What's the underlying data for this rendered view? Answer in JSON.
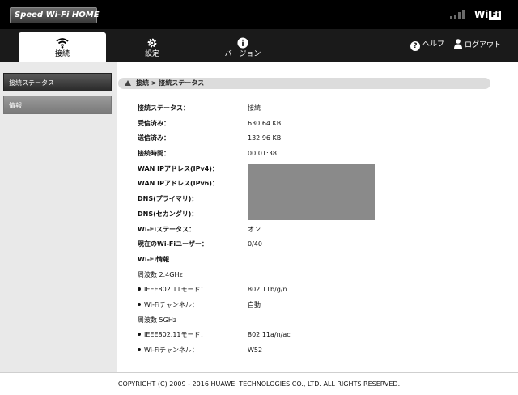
{
  "header": {
    "logo_text": "Speed Wi-Fi HOME",
    "wifi_logo": "WiFi"
  },
  "nav": {
    "tabs": [
      {
        "label": "接続",
        "icon": "wifi-connection-icon"
      },
      {
        "label": "設定",
        "icon": "gear-icon"
      },
      {
        "label": "バージョン",
        "icon": "info-icon"
      }
    ],
    "help_label": "ヘルプ",
    "logout_label": "ログアウト"
  },
  "sidebar": {
    "items": [
      {
        "label": "接続ステータス"
      },
      {
        "label": "情報"
      }
    ]
  },
  "breadcrumb": "接続 > 接続ステータス",
  "status": {
    "connection_status": {
      "label": "接続ステータス：",
      "value": "接続"
    },
    "received": {
      "label": "受信済み：",
      "value": "630.64 KB"
    },
    "sent": {
      "label": "送信済み：",
      "value": "132.96 KB"
    },
    "connection_time": {
      "label": "接続時間：",
      "value": "00:01:38"
    },
    "wan_ipv4": {
      "label": "WAN IPアドレス(IPv4)："
    },
    "wan_ipv6": {
      "label": "WAN IPアドレス(IPv6)："
    },
    "dns_primary": {
      "label": "DNS(プライマリ)："
    },
    "dns_secondary": {
      "label": "DNS(セカンダリ)："
    },
    "wifi_status": {
      "label": "Wi-Fiステータス：",
      "value": "オン"
    },
    "wifi_users": {
      "label": "現在のWi-Fiユーザー：",
      "value": "0/40"
    },
    "wifi_info_title": "Wi-Fi情報",
    "band_24": {
      "title": "周波数 2.4GHz",
      "mode": {
        "label": "IEEE802.11モード：",
        "value": "802.11b/g/n"
      },
      "channel": {
        "label": "Wi-Fiチャンネル：",
        "value": "自動"
      }
    },
    "band_5": {
      "title": "周波数 5GHz",
      "mode": {
        "label": "IEEE802.11モード：",
        "value": "802.11a/n/ac"
      },
      "channel": {
        "label": "Wi-Fiチャンネル：",
        "value": "W52"
      }
    }
  },
  "footer": "COPYRIGHT (C) 2009 - 2016 HUAWEI TECHNOLOGIES CO., LTD. ALL RIGHTS RESERVED."
}
